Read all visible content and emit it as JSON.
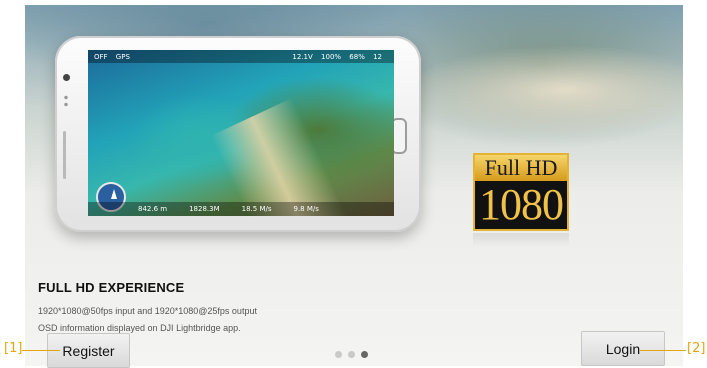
{
  "slide": {
    "title": "FULL HD EXPERIENCE",
    "description_line1": "1920*1080@50fps input and 1920*1080@25fps output",
    "description_line2": "OSD information displayed on DJI Lightbridge app.",
    "badge": {
      "line1": "Full HD",
      "line2": "1080"
    },
    "osd": {
      "top_left": [
        "OFF",
        "GPS"
      ],
      "top_right": [
        "12.1V",
        "100%",
        "68%",
        "12"
      ],
      "bottom": [
        "842.6 m",
        "1828.3M",
        "18.5 M/s",
        "9.8 M/s"
      ]
    },
    "pager": {
      "count": 3,
      "active_index": 2
    }
  },
  "buttons": {
    "register_label": "Register",
    "login_label": "Login"
  },
  "annotations": {
    "callout_1": "[1]",
    "callout_2": "[2]"
  },
  "colors": {
    "callout": "#e3a514",
    "badge_gold": "#f1c24a"
  }
}
